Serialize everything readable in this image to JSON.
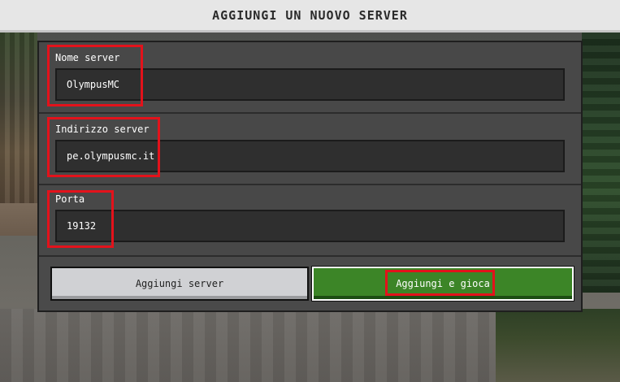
{
  "title": "AGGIUNGI UN NUOVO SERVER",
  "fields": [
    {
      "label": "Nome server",
      "value": "OlympusMC"
    },
    {
      "label": "Indirizzo server",
      "value": "pe.olympusmc.it"
    },
    {
      "label": "Porta",
      "value": "19132"
    }
  ],
  "buttons": {
    "add": "Aggiungi server",
    "add_and_play": "Aggiungi e gioca"
  },
  "colors": {
    "highlight": "#e3121b",
    "play_button": "#3c8527",
    "add_button": "#d0d1d4"
  }
}
